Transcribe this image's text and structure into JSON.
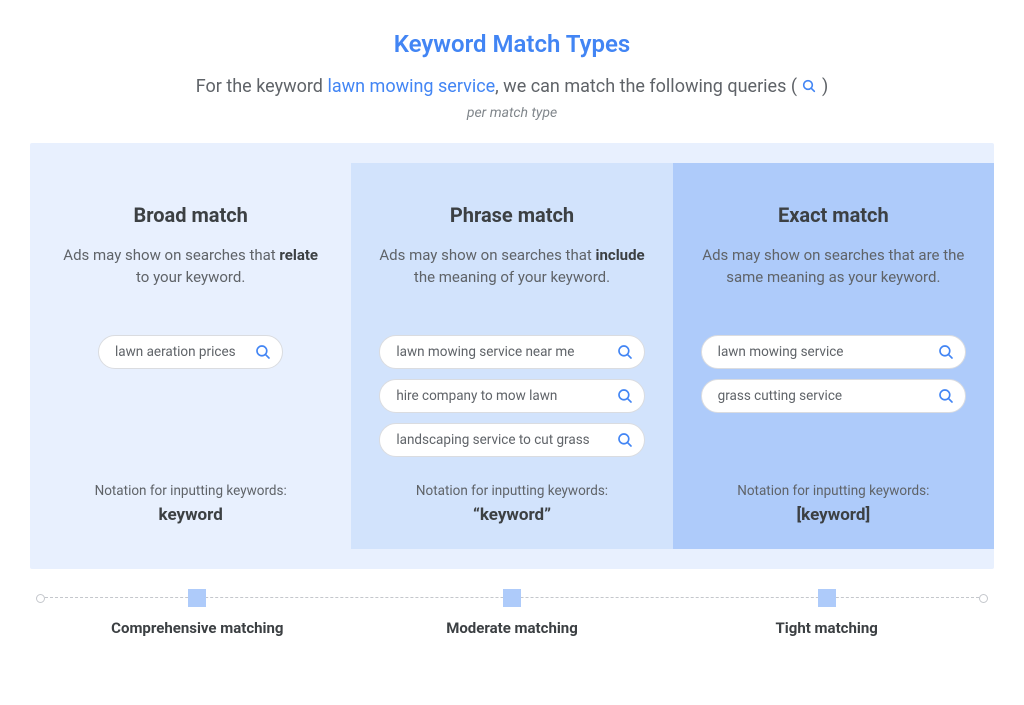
{
  "title": "Keyword Match Types",
  "subtitle_pre": "For the keyword ",
  "subtitle_keyword": "lawn mowing service",
  "subtitle_post": ", we can match the following queries ( ",
  "subtitle_close": " )",
  "per_match": "per match type",
  "columns": {
    "broad": {
      "heading": "Broad match",
      "desc_pre": "Ads may show on searches that ",
      "desc_bold": "relate",
      "desc_post": " to your keyword.",
      "queries": [
        "lawn aeration prices"
      ],
      "notation_label": "Notation for inputting keywords:",
      "notation": "keyword"
    },
    "phrase": {
      "heading": "Phrase match",
      "desc_pre": "Ads may show on searches that ",
      "desc_bold": "include",
      "desc_post": " the meaning of your keyword.",
      "queries": [
        "lawn mowing service near me",
        "hire company to mow lawn",
        "landscaping service to cut grass"
      ],
      "notation_label": "Notation for inputting keywords:",
      "notation": "“keyword”"
    },
    "exact": {
      "heading": "Exact match",
      "desc_pre": "Ads may show on searches that are the same meaning as your keyword.",
      "desc_bold": "",
      "desc_post": "",
      "queries": [
        "lawn mowing service",
        "grass cutting service"
      ],
      "notation_label": "Notation for inputting keywords:",
      "notation": "[keyword]"
    }
  },
  "timeline": {
    "broad": "Comprehensive matching",
    "phrase": "Moderate matching",
    "exact": "Tight matching"
  }
}
